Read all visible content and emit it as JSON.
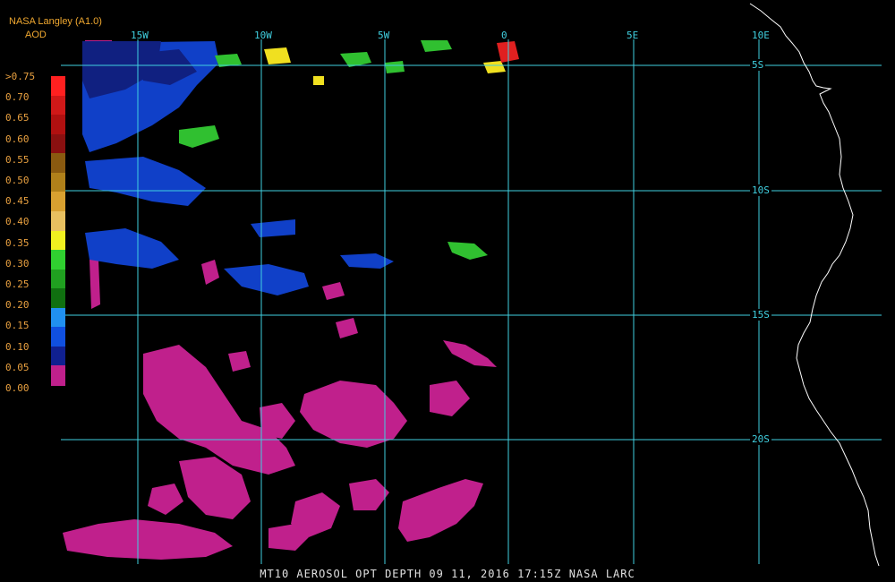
{
  "header": {
    "source": "NASA Langley (A1.0)",
    "product": "AOD"
  },
  "legend": {
    "labels": [
      ">0.75",
      "0.70",
      "0.65",
      "0.60",
      "0.55",
      "0.50",
      "0.45",
      "0.40",
      "0.35",
      "0.30",
      "0.25",
      "0.20",
      "0.15",
      "0.10",
      "0.05",
      "0.00"
    ],
    "colors": [
      "#ff2020",
      "#d01818",
      "#b01010",
      "#8a1010",
      "#8a5a10",
      "#b0801a",
      "#d8a030",
      "#e8c060",
      "#f0f020",
      "#30d030",
      "#20a020",
      "#107010",
      "#2090f0",
      "#1050e0",
      "#102090",
      "#c0208c"
    ]
  },
  "grid": {
    "lon_labels": [
      "15W",
      "10W",
      "5W",
      "0",
      "5E",
      "10E"
    ],
    "lat_labels": [
      "5S",
      "10S",
      "15S",
      "20S"
    ],
    "line_color": "#40d0e0"
  },
  "footer": {
    "caption": "MT10  AEROSOL OPT DEPTH   09 11, 2016 17:15Z   NASA LARC"
  }
}
